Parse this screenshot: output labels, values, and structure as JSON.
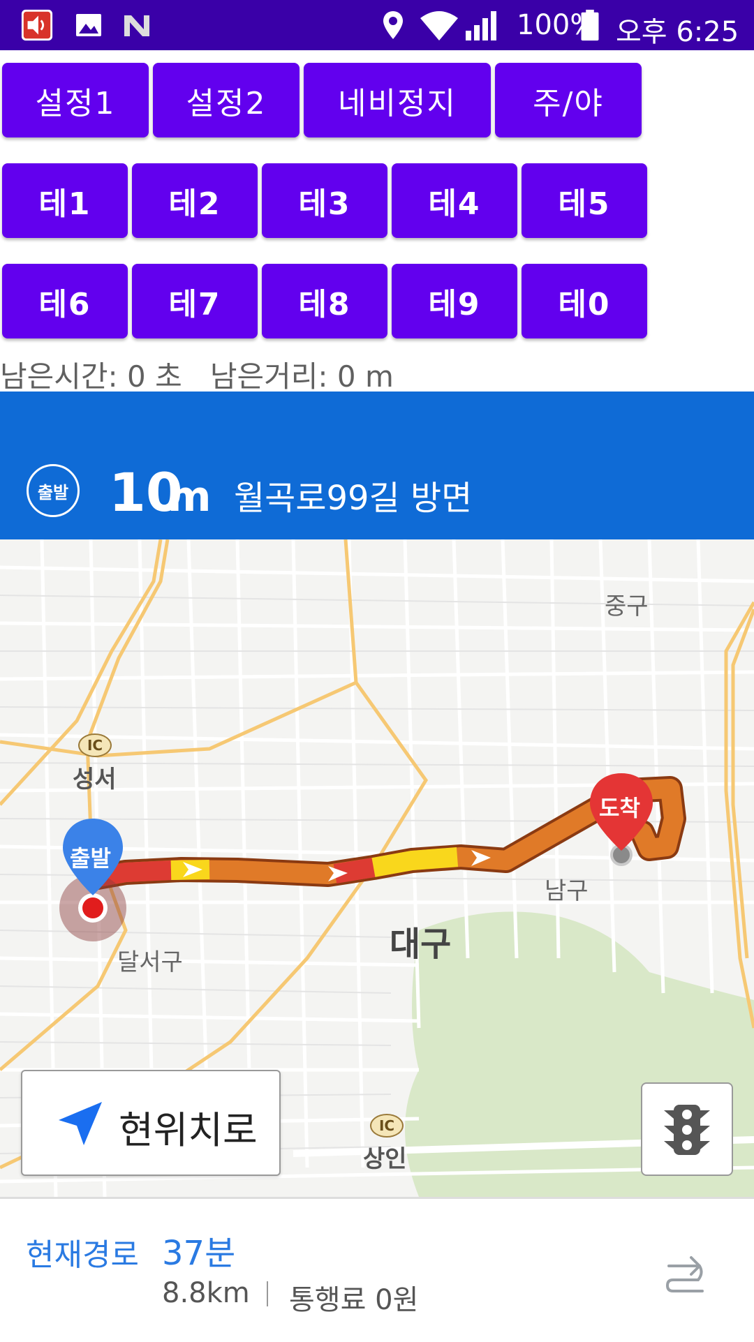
{
  "status_bar": {
    "battery": "100%",
    "time": "오후 6:25",
    "icons": [
      "speaker-icon",
      "image-icon",
      "n-logo-icon",
      "location-icon",
      "wifi-icon",
      "signal-icon",
      "battery-icon"
    ]
  },
  "controls": {
    "row1": [
      "설정1",
      "설정2",
      "네비정지",
      "주/야"
    ],
    "row2": [
      "테1",
      "테2",
      "테3",
      "테4",
      "테5"
    ],
    "row3": [
      "테6",
      "테7",
      "테8",
      "테9",
      "테0"
    ]
  },
  "remaining": {
    "text": "남은시간: 0 초   남은거리: 0 m"
  },
  "guidance": {
    "badge": "출발",
    "distance_value": "10",
    "distance_unit": "m",
    "road": "월곡로99길 방면"
  },
  "map": {
    "labels": {
      "junggu": "중구",
      "seongseo": "성서",
      "ic": "IC",
      "namgu": "남구",
      "dalseogu": "달서구",
      "daegu": "대구",
      "sangin": "상인"
    },
    "start_marker": "출발",
    "end_marker": "도착",
    "current_location_button": "현위치로",
    "traffic_button_icon": "traffic-light-icon"
  },
  "route_summary": {
    "name": "현재경로",
    "time": "37분",
    "distance": "8.8km",
    "toll": "통행료 0원"
  },
  "colors": {
    "status_bar": "#3a00a8",
    "button": "#6200ee",
    "banner": "#0f6bd6",
    "route_accent": "#2a7ae2"
  }
}
